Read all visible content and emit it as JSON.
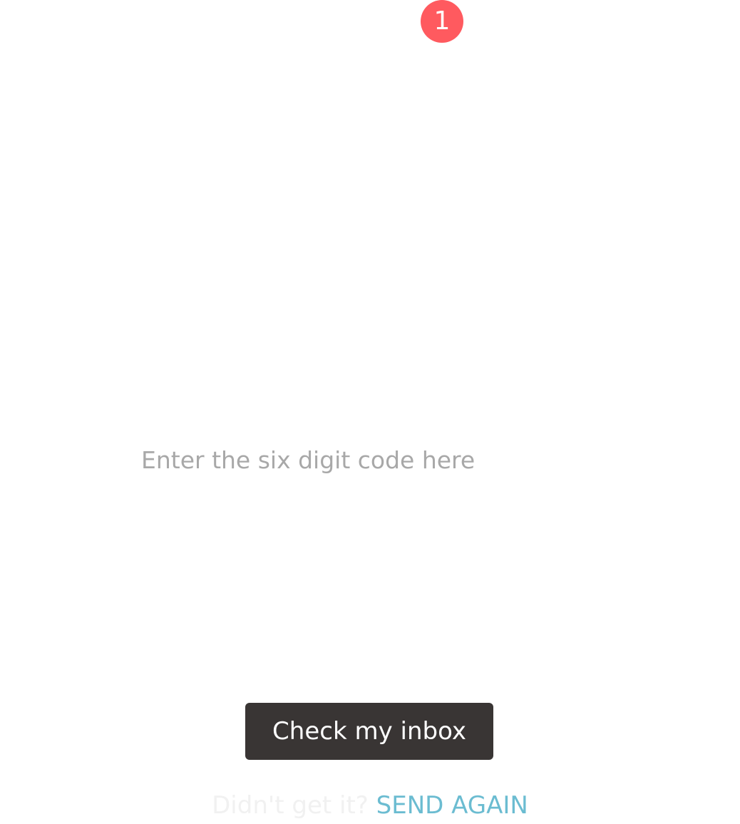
{
  "notification_badge": {
    "count": "1",
    "color": "#ff5a5f"
  },
  "code_entry": {
    "placeholder": "Enter the six digit code here",
    "value": ""
  },
  "primary_action": {
    "label": "Check my inbox",
    "color": "#393534"
  },
  "resend": {
    "prompt": "Didn't get it?",
    "link_label": "SEND AGAIN",
    "link_color": "#6bbcd1"
  }
}
